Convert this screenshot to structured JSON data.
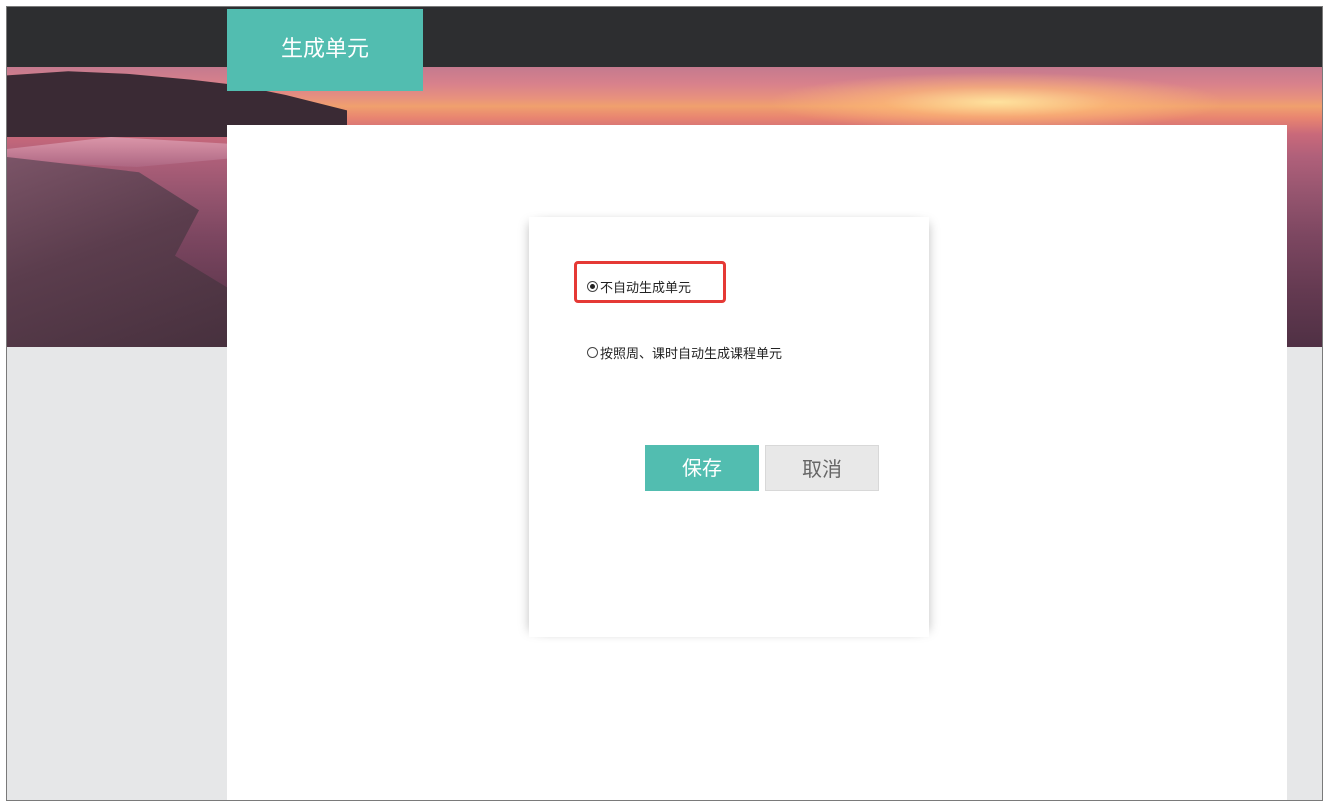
{
  "header": {
    "tab_title": "生成单元"
  },
  "dialog": {
    "options": [
      {
        "label": "不自动生成单元",
        "selected": true
      },
      {
        "label": "按照周、课时自动生成课程单元",
        "selected": false
      }
    ],
    "save_label": "保存",
    "cancel_label": "取消"
  },
  "colors": {
    "accent": "#52bdb0",
    "highlight_border": "#e53935",
    "topbar": "#2d2e30",
    "page_background": "#e6e7e8"
  }
}
